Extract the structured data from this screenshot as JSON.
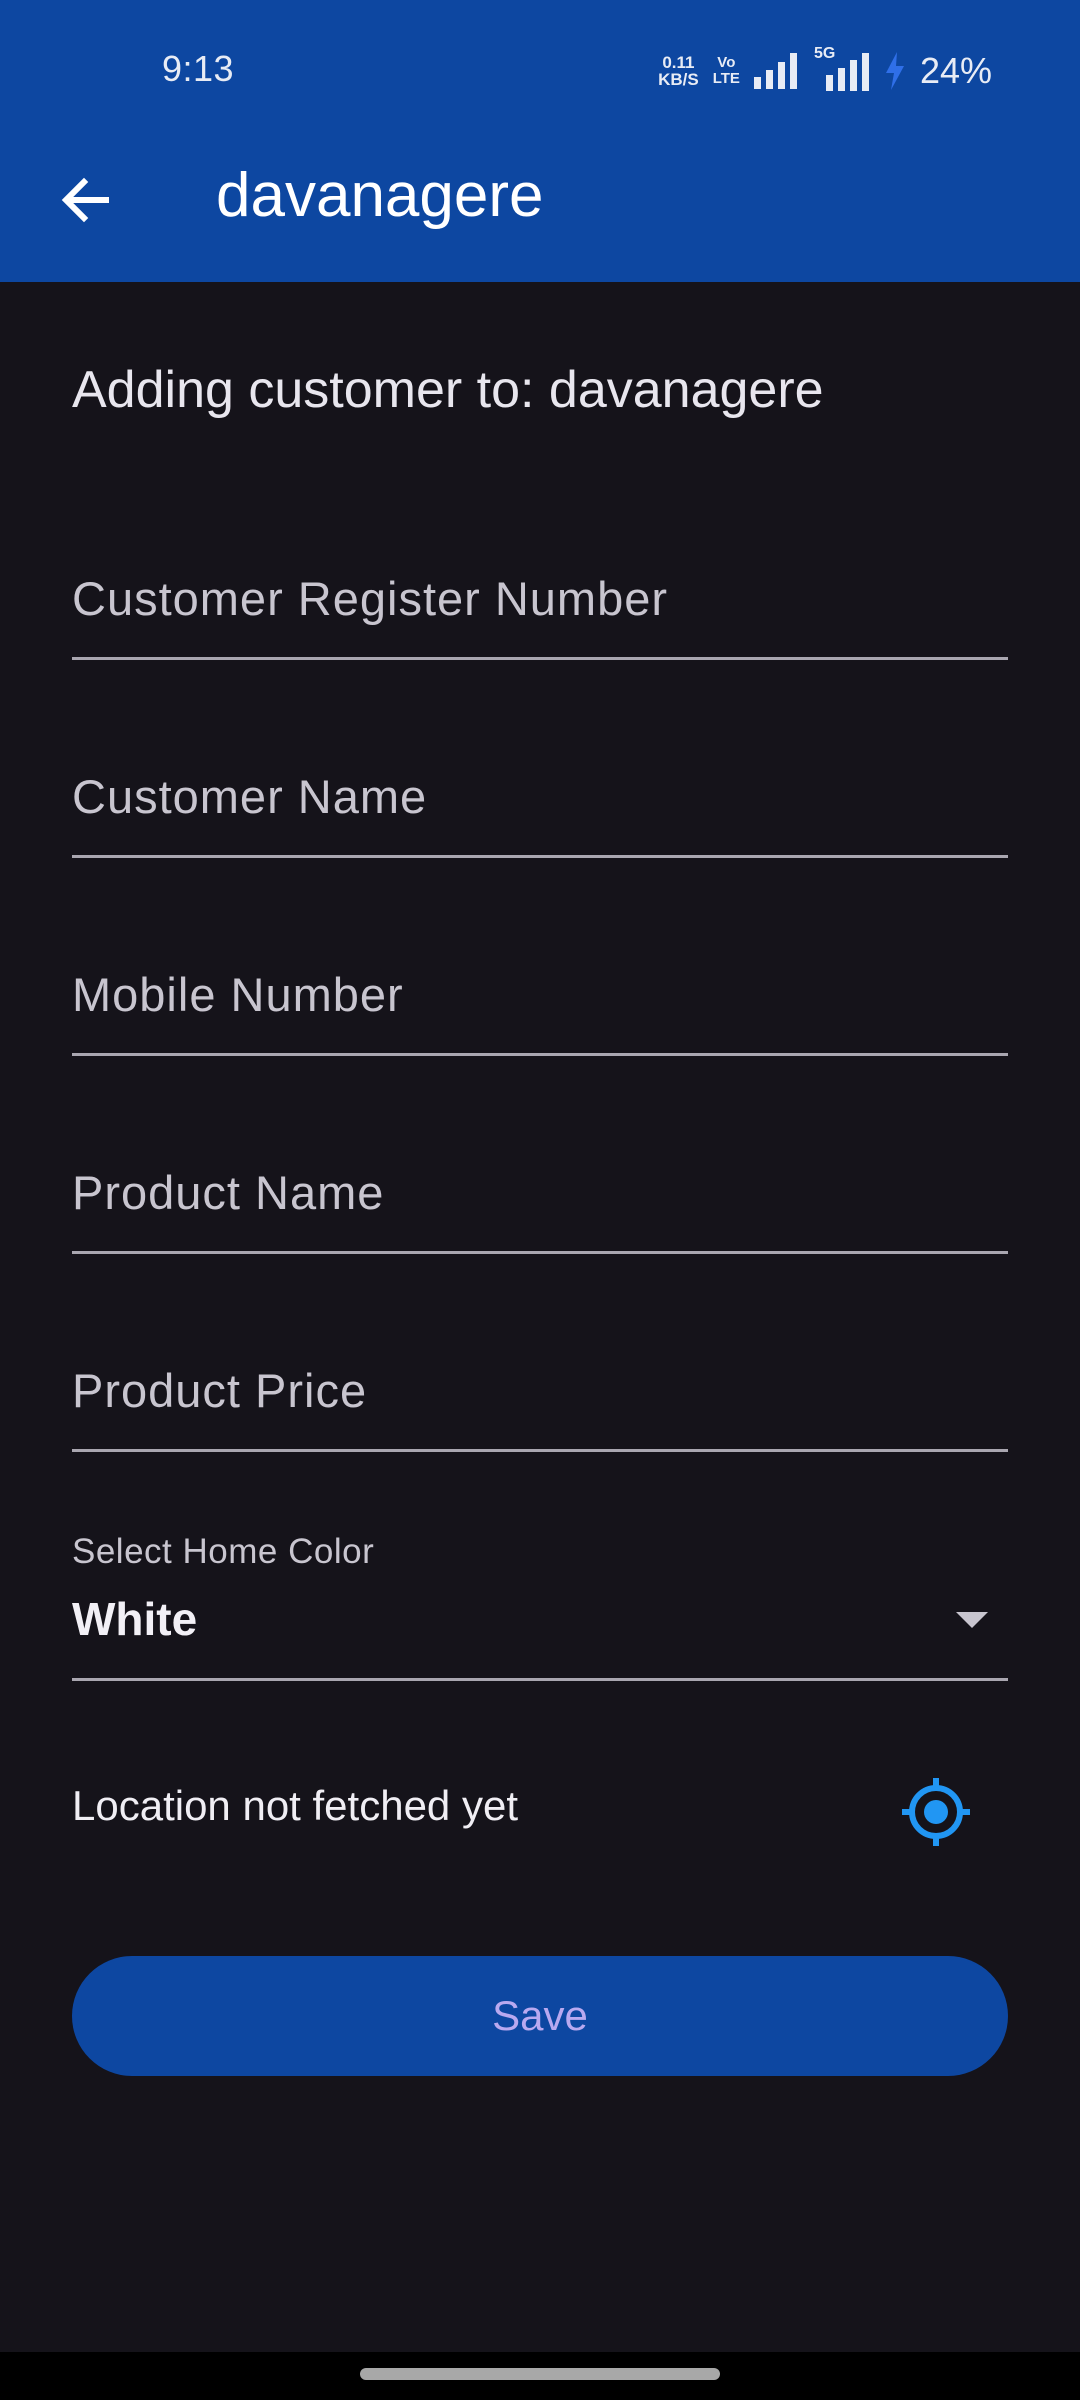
{
  "status_bar": {
    "time": "9:13",
    "net_speed_value": "0.11",
    "net_speed_unit": "KB/S",
    "volte_top": "Vo",
    "volte_bottom": "LTE",
    "network_label": "5G",
    "battery": "24%"
  },
  "app_bar": {
    "title": "davanagere",
    "back_icon": "arrow-back-icon"
  },
  "form": {
    "heading": "Adding customer to: davanagere",
    "register_number_placeholder": "Customer Register Number",
    "customer_name_placeholder": "Customer Name",
    "mobile_number_placeholder": "Mobile Number",
    "product_name_placeholder": "Product Name",
    "product_price_placeholder": "Product Price",
    "home_color_label": "Select Home Color",
    "home_color_value": "White",
    "location_status": "Location not fetched yet",
    "location_icon": "gps-fixed-icon",
    "save_label": "Save"
  },
  "colors": {
    "primary": "#0d47a1",
    "background": "#15131a",
    "accent_icon": "#2196f3",
    "save_text": "#b9a9f0"
  }
}
